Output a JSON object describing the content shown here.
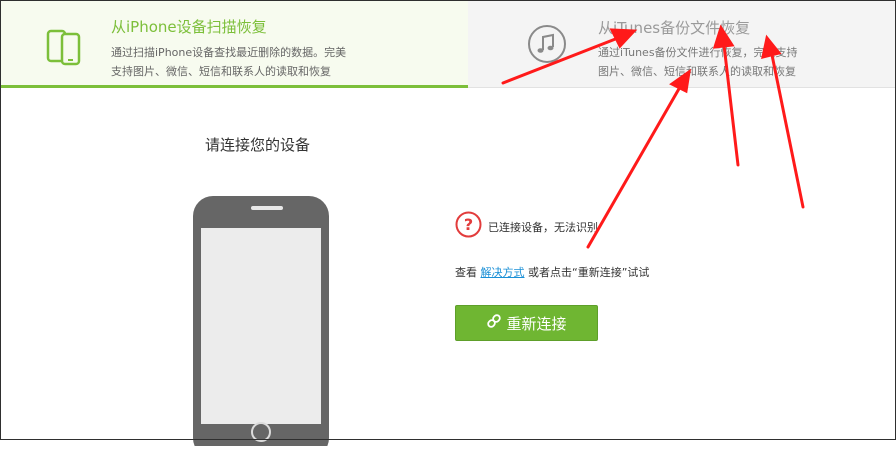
{
  "tabs": {
    "scan": {
      "title": "从iPhone设备扫描恢复",
      "desc_line1": "通过扫描iPhone设备查找最近删除的数据。完美",
      "desc_line2": "支持图片、微信、短信和联系人的读取和恢复",
      "icon": "phones-icon"
    },
    "itunes": {
      "title": "从iTunes备份文件恢复",
      "desc_line1": "通过iTunes备份文件进行恢复，完美支持",
      "desc_line2": "图片、微信、短信和联系人的读取和恢复",
      "icon": "music-note-icon"
    }
  },
  "main": {
    "prompt": "请连接您的设备",
    "error_text": "已连接设备，无法识别",
    "help_prefix": "查看",
    "help_link": "解决方式",
    "help_suffix": "或者点击“重新连接”试试",
    "reconnect_label": "重新连接"
  },
  "colors": {
    "accent_green": "#7cbf3a",
    "button_green": "#6fb632",
    "error_red": "#e23c3c",
    "link_blue": "#1a8fd6",
    "annotation_red": "#ff1a1a"
  }
}
